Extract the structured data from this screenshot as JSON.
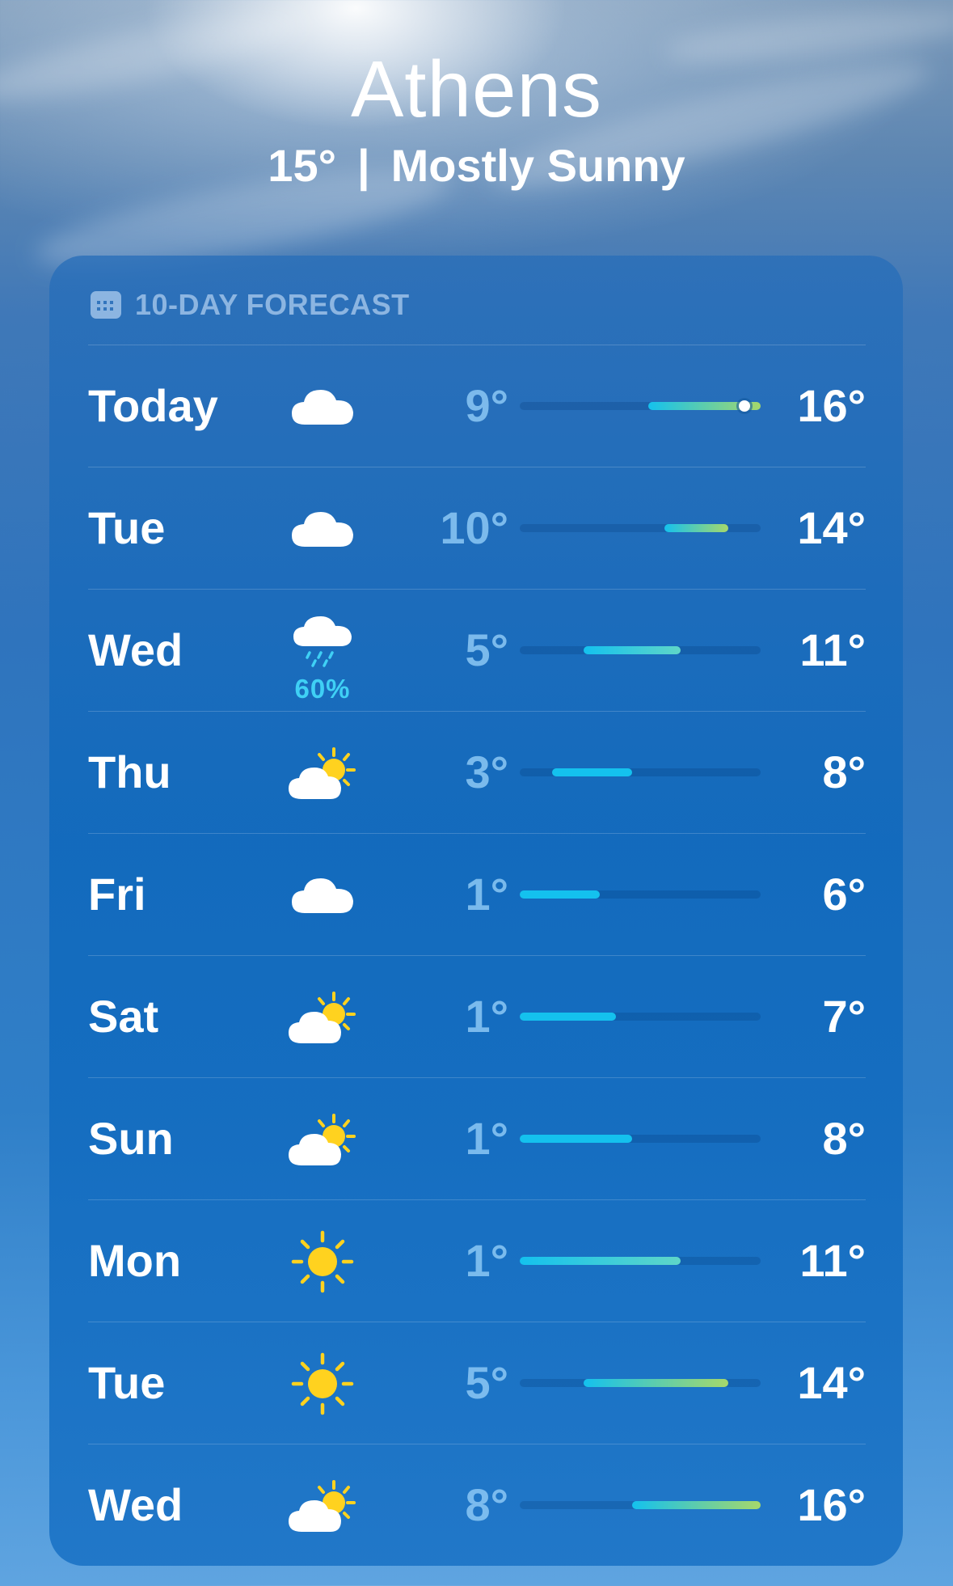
{
  "location": {
    "city": "Athens",
    "current_temp": "15°",
    "separator": "|",
    "condition": "Mostly Sunny"
  },
  "forecast": {
    "header": "10-DAY FORECAST",
    "icon": "calendar-icon",
    "range_min": 1,
    "range_max": 16,
    "current_temp_value": 15,
    "days": [
      {
        "day": "Today",
        "icon": "cloud",
        "low": "9°",
        "high": "16°",
        "low_value": 9,
        "high_value": 16,
        "precip": null,
        "current": true
      },
      {
        "day": "Tue",
        "icon": "cloud",
        "low": "10°",
        "high": "14°",
        "low_value": 10,
        "high_value": 14,
        "precip": null
      },
      {
        "day": "Wed",
        "icon": "cloud-rain",
        "low": "5°",
        "high": "11°",
        "low_value": 5,
        "high_value": 11,
        "precip": "60%"
      },
      {
        "day": "Thu",
        "icon": "partly-sunny",
        "low": "3°",
        "high": "8°",
        "low_value": 3,
        "high_value": 8,
        "precip": null
      },
      {
        "day": "Fri",
        "icon": "cloud",
        "low": "1°",
        "high": "6°",
        "low_value": 1,
        "high_value": 6,
        "precip": null
      },
      {
        "day": "Sat",
        "icon": "partly-sunny",
        "low": "1°",
        "high": "7°",
        "low_value": 1,
        "high_value": 7,
        "precip": null
      },
      {
        "day": "Sun",
        "icon": "partly-sunny",
        "low": "1°",
        "high": "8°",
        "low_value": 1,
        "high_value": 8,
        "precip": null
      },
      {
        "day": "Mon",
        "icon": "sun",
        "low": "1°",
        "high": "11°",
        "low_value": 1,
        "high_value": 11,
        "precip": null
      },
      {
        "day": "Tue",
        "icon": "sun",
        "low": "5°",
        "high": "14°",
        "low_value": 5,
        "high_value": 14,
        "precip": null
      },
      {
        "day": "Wed",
        "icon": "partly-sunny",
        "low": "8°",
        "high": "16°",
        "low_value": 8,
        "high_value": 16,
        "precip": null
      }
    ]
  },
  "colors": {
    "cold": "#14c1ee",
    "mild": "#5fd6c8",
    "warm": "#a6d86b",
    "precip": "#3fd0f5",
    "sun": "#ffd21f"
  }
}
